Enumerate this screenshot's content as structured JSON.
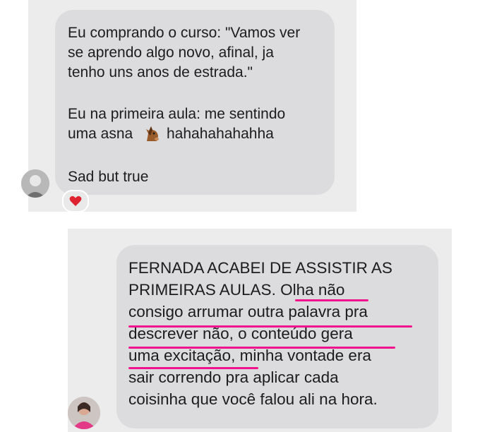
{
  "messages": [
    {
      "lines": [
        "Eu comprando o curso: \"Vamos ver",
        "se aprendo algo novo, afinal, ja",
        "tenho uns anos de estrada.\"",
        "Eu na primeira aula: me sentindo",
        "uma asna",
        "hahahahahahha",
        "Sad but true"
      ],
      "emoji": "horse-face-icon",
      "reaction": "heart-icon"
    },
    {
      "lines": [
        "FERNADA ACABEI DE ASSISTIR AS",
        "PRIMEIRAS AULAS. Olha não",
        "consigo arrumar outra palavra pra",
        "descrever não, o conteúdo gera",
        "uma excitação, minha vontade era",
        "sair correndo pra aplicar cada",
        "coisinha que você falou ali na hora."
      ],
      "highlight_color": "#f0128a"
    }
  ]
}
